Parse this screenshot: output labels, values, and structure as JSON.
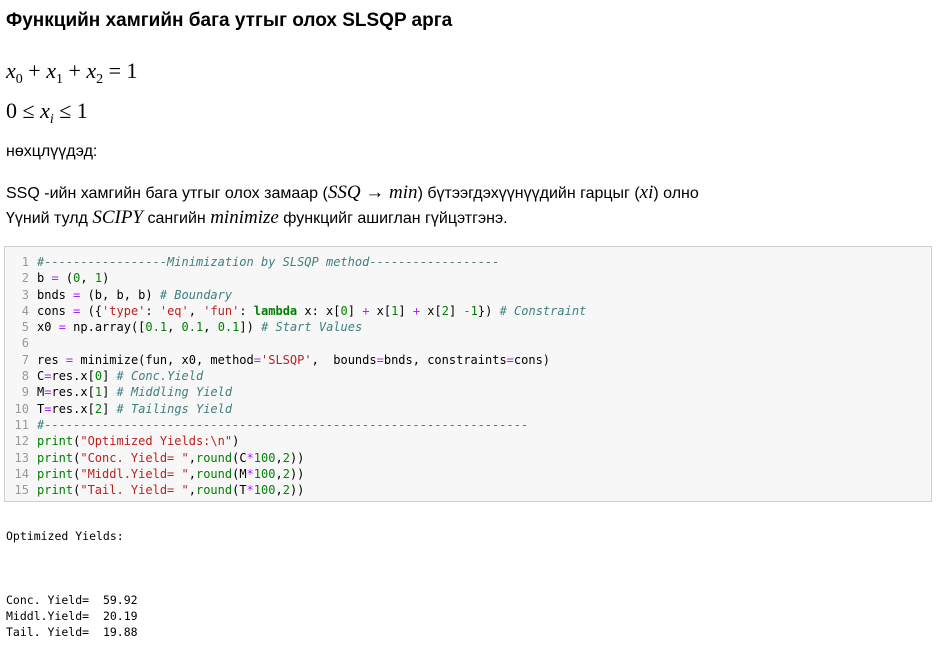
{
  "heading": "Функцийн хамгийн бага утгыг олох SLSQP арга",
  "equations": {
    "sum_constraint": "x0 + x1 + x2 = 1",
    "bound_constraint": "0 ≤ xi ≤ 1"
  },
  "condition_label": "нөхцлүүдэд:",
  "paragraph": {
    "line1_a": "SSQ -ийн хамгийн бага утгыг олох замаар (",
    "line1_math": "SSQ → min",
    "line1_b": ") бүтээгдэхүүнүүдийн гарцыг (",
    "line1_var": "xi",
    "line1_c": ") олно",
    "line2_a": "Үүний тулд ",
    "line2_math": "SCIPY",
    "line2_b": " сангийн ",
    "line2_math2": "minimize",
    "line2_c": " функцийг ашиглан гүйцэтгэнэ."
  },
  "code": {
    "line_numbers": [
      "1",
      "2",
      "3",
      "4",
      "5",
      "6",
      "7",
      "8",
      "9",
      "10",
      "11",
      "12",
      "13",
      "14",
      "15"
    ],
    "lines": [
      "#-----------------Minimization by SLSQP method------------------",
      "b = (0, 1)",
      "bnds = (b, b, b) # Boundary",
      "cons = ({'type': 'eq', 'fun': lambda x: x[0] + x[1] + x[2] -1}) # Constraint",
      "x0 = np.array([0.1, 0.1, 0.1]) # Start Values",
      "",
      "res = minimize(fun, x0, method='SLSQP',  bounds=bnds, constraints=cons)",
      "C=res.x[0] # Conc.Yield",
      "M=res.x[1] # Middling Yield",
      "T=res.x[2] # Tailings Yield",
      "#-------------------------------------------------------------------",
      "print(\"Optimized Yields:\\n\")",
      "print(\"Conc. Yield= \",round(C*100,2))",
      "print(\"Middl.Yield= \",round(M*100,2))",
      "print(\"Tail. Yield= \",round(T*100,2))"
    ]
  },
  "output": {
    "title": "Optimized Yields:",
    "rows": [
      {
        "label": "Conc. Yield=",
        "value": "59.92"
      },
      {
        "label": "Middl.Yield=",
        "value": "20.19"
      },
      {
        "label": "Tail. Yield=",
        "value": "19.88"
      }
    ]
  }
}
